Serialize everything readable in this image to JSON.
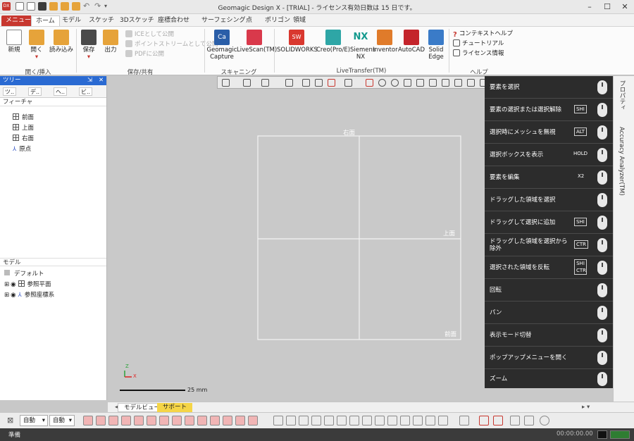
{
  "window": {
    "title": "Geomagic Design X - [TRIAL] - ライセンス有効日数は 15 日です。",
    "app_icon": "DX"
  },
  "tabs": [
    "メニュー",
    "ホーム",
    "モデル",
    "スケッチ",
    "3Dスケッチ",
    "座標合わせ",
    "サーフェシング",
    "点",
    "ポリゴン",
    "領域"
  ],
  "ribbon": {
    "groups": {
      "open_insert": "開く/挿入",
      "save_share": "保存/共有",
      "scanning": "スキャニング",
      "livetransfer": "LiveTransfer(TM)",
      "help": "ヘルプ"
    },
    "new": "新規",
    "open": "開く",
    "import": "読み込み",
    "save": "保存",
    "export": "出力",
    "share_items": [
      "ICEとして公開",
      "ポイントストリームとして公開",
      "PDFに公開"
    ],
    "capture": "Geomagic Capture",
    "livescan": "LiveScan(TM)",
    "transfer": [
      "SOLIDWORKS",
      "Creo(Pro/E)",
      "Siemens NX",
      "Inventor",
      "AutoCAD",
      "Solid Edge"
    ],
    "help_items": [
      "コンテキストヘルプ",
      "チュートリアル",
      "ライセンス情報"
    ]
  },
  "tree": {
    "header": "ツリー",
    "tab_labels": [
      "ツ..",
      "デ..",
      "ヘ..",
      "ビ.."
    ],
    "feature_section": "フィーチャ",
    "features": [
      "前面",
      "上面",
      "右面",
      "原点"
    ],
    "model_section": "モデル",
    "model_items": [
      "デフォルト",
      "参照平面",
      "参照座標系"
    ]
  },
  "viewport": {
    "plane_labels": [
      "右面",
      "上面",
      "前面"
    ],
    "scale_label": "25 mm",
    "axis_z": "Z",
    "axis_x": "X"
  },
  "popup": {
    "rows": [
      {
        "label": "要素を選択",
        "key": ""
      },
      {
        "label": "要素の選択または選択解除",
        "key": "SHI"
      },
      {
        "label": "選択時にメッシュを無視",
        "key": "ALT"
      },
      {
        "label": "選択ボックスを表示",
        "key": "HOLD"
      },
      {
        "label": "要素を編集",
        "key": "X2"
      },
      {
        "label": "ドラッグした領域を選択",
        "key": ""
      },
      {
        "label": "ドラッグして選択に追加",
        "key": "SHI"
      },
      {
        "label": "ドラッグした領域を選択から除外",
        "key": "CTR"
      },
      {
        "label": "選択された領域を反転",
        "key": "SHI CTR"
      },
      {
        "label": "回転",
        "key": ""
      },
      {
        "label": "パン",
        "key": ""
      },
      {
        "label": "表示モード切替",
        "key": ""
      },
      {
        "label": "ポップアップメニューを開く",
        "key": ""
      },
      {
        "label": "ズーム",
        "key": ""
      }
    ]
  },
  "right_strip": {
    "tabs": [
      "プロパティ",
      "Accuracy Analyzer(TM)"
    ]
  },
  "bottom": {
    "view_tab": "モデルビュー",
    "support_tab": "サポート",
    "select1": "自動",
    "select2": "自動"
  },
  "status": {
    "text": "準備",
    "time": "00:00:00.00"
  },
  "colors": {
    "accent_red": "#c7372f",
    "panel_dark": "#2c2c2c",
    "tree_header": "#2a6ad2",
    "support_tab": "#f5d547"
  }
}
